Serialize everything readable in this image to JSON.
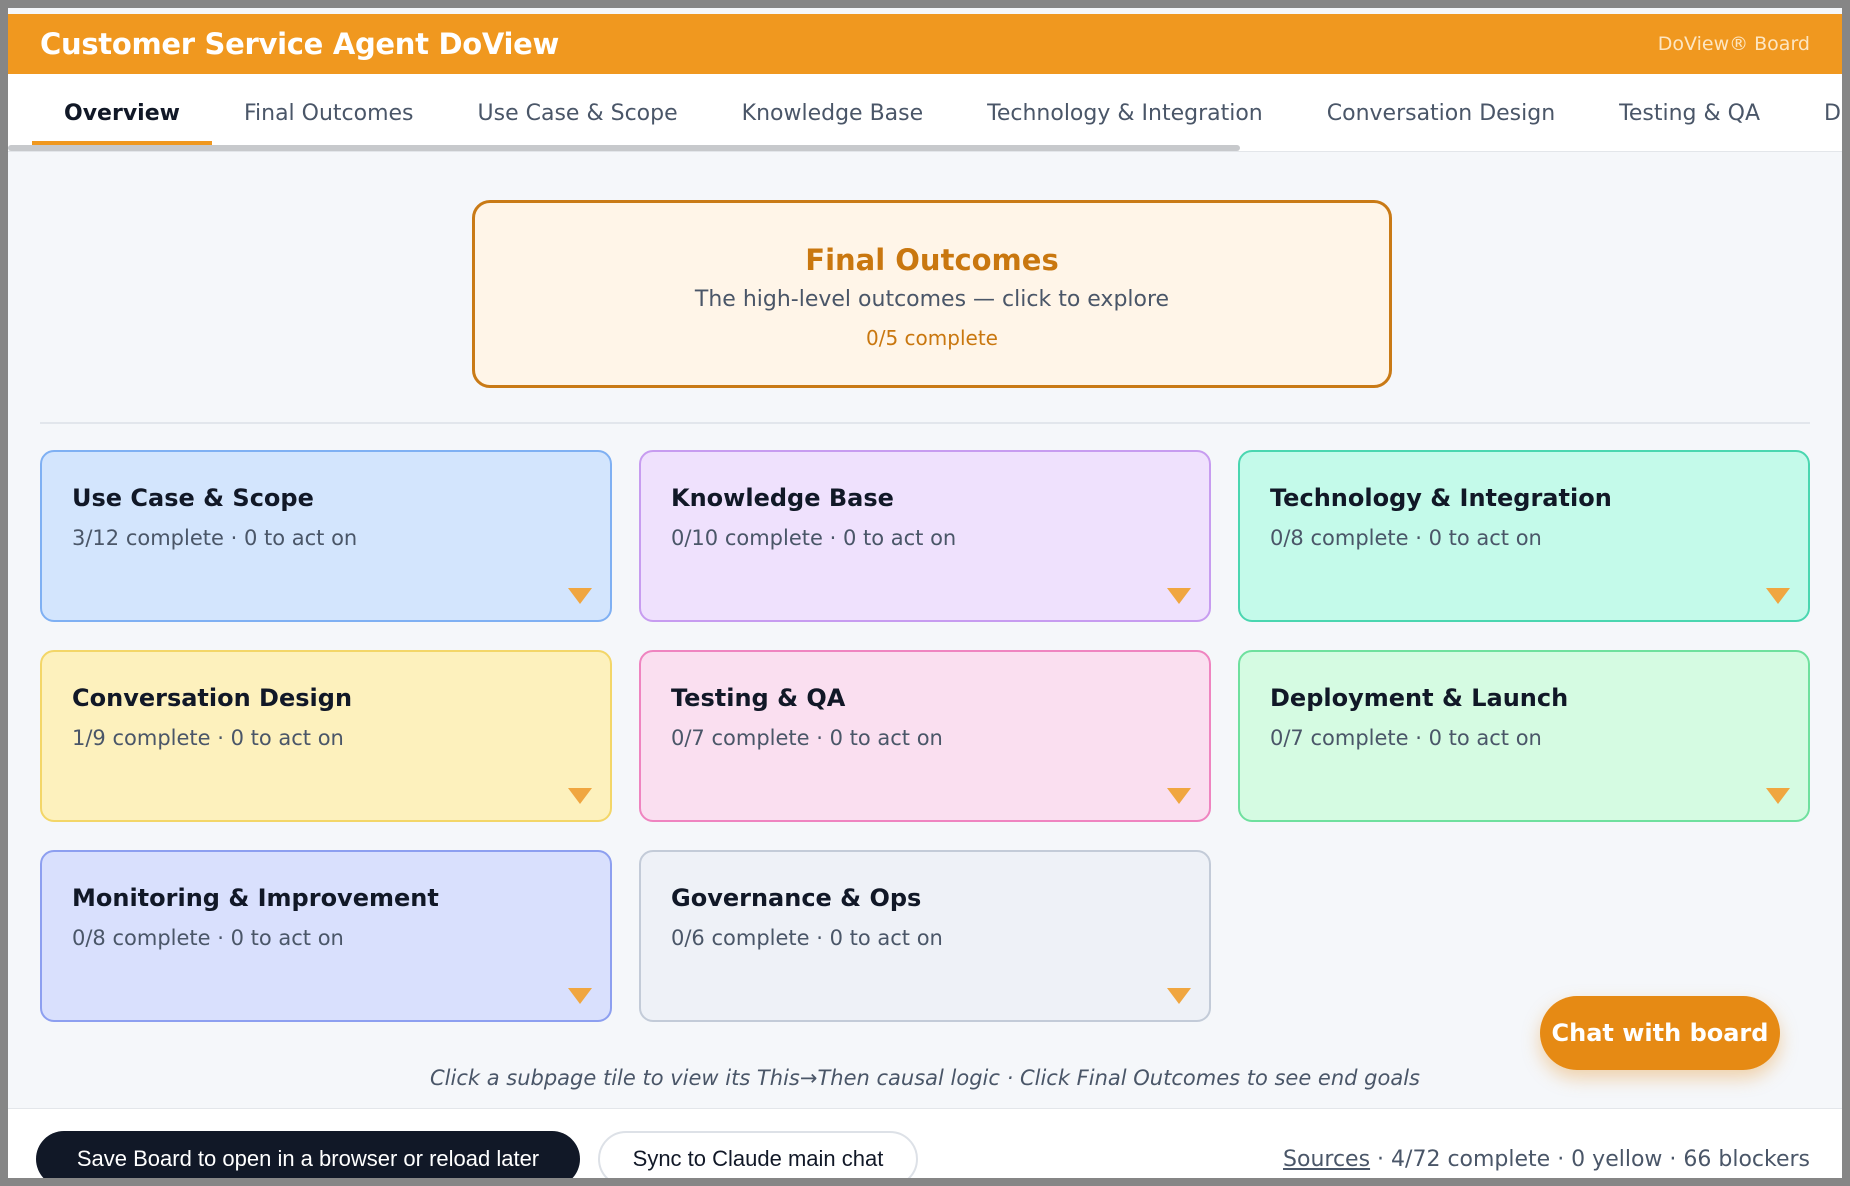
{
  "header": {
    "title": "Customer Service Agent DoView",
    "badge": "DoView® Board"
  },
  "tabs": [
    {
      "label": "Overview",
      "active": true
    },
    {
      "label": "Final Outcomes"
    },
    {
      "label": "Use Case & Scope"
    },
    {
      "label": "Knowledge Base"
    },
    {
      "label": "Technology & Integration"
    },
    {
      "label": "Conversation Design"
    },
    {
      "label": "Testing & QA"
    },
    {
      "label": "D"
    }
  ],
  "hero": {
    "title": "Final Outcomes",
    "subtitle": "The high-level outcomes — click to explore",
    "count": "0/5 complete"
  },
  "tiles": [
    {
      "title": "Use Case & Scope",
      "count": "3/12 complete · 0 to act on",
      "color": "#d3e5fd"
    },
    {
      "title": "Knowledge Base",
      "count": "0/10 complete · 0 to act on",
      "color": "#efe1fd"
    },
    {
      "title": "Technology & Integration",
      "count": "0/8 complete · 0 to act on",
      "color": "#c4faea"
    },
    {
      "title": "Conversation Design",
      "count": "1/9 complete · 0 to act on",
      "color": "#fdf1bd"
    },
    {
      "title": "Testing & QA",
      "count": "0/7 complete · 0 to act on",
      "color": "#fadff0"
    },
    {
      "title": "Deployment & Launch",
      "count": "0/7 complete · 0 to act on",
      "color": "#d5fbe2"
    },
    {
      "title": "Monitoring & Improvement",
      "count": "0/8 complete · 0 to act on",
      "color": "#d9e0fd"
    },
    {
      "title": "Governance & Ops",
      "count": "0/6 complete · 0 to act on",
      "color": "#eef1f7"
    }
  ],
  "hint": "Click a subpage tile to view its This→Then causal logic · Click Final Outcomes to see end goals",
  "chat_button": "Chat with board",
  "footer": {
    "save_label": "Save Board to open in a browser or reload later",
    "sync_label": "Sync to Claude main chat",
    "sources_link": "Sources",
    "status_text": " · 4/72 complete · 0 yellow · 66 blockers"
  },
  "colors": {
    "accent": "#f0981f",
    "hero_border": "#c97a16",
    "dark_button": "#111827"
  },
  "icons": {
    "tile_caret": "caret-down-icon"
  }
}
